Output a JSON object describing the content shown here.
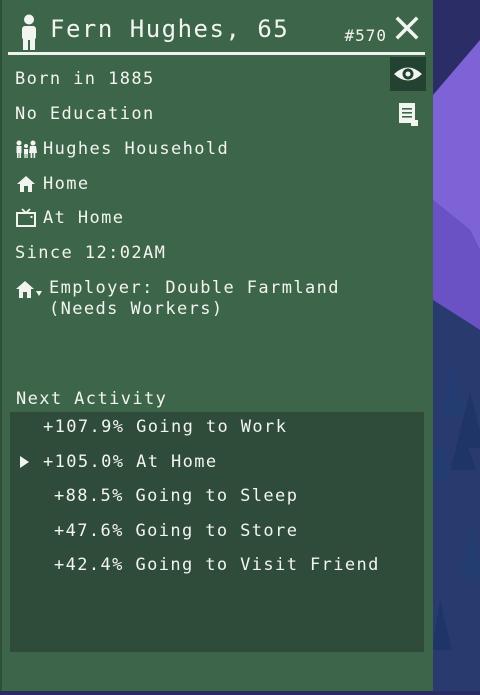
{
  "citizen": {
    "name": "Fern Hughes, 65",
    "id": "#570",
    "born": "Born in 1885",
    "education": "No Education",
    "household": "Hughes Household",
    "home": "Home",
    "status": "At Home",
    "since": "Since 12:02AM",
    "employer": "Employer: Double Farmland (Needs Workers)"
  },
  "next_activity": {
    "label": "Next Activity",
    "items": [
      {
        "text": "+107.9% Going to Work",
        "current": false
      },
      {
        "text": "+105.0% At Home",
        "current": true
      },
      {
        "text": "+88.5% Going to Sleep",
        "current": false
      },
      {
        "text": "+47.6% Going to Store",
        "current": false
      },
      {
        "text": "+42.4% Going to Visit Friend",
        "current": false
      }
    ]
  },
  "icons": {
    "person": "person-icon",
    "close": "close-icon",
    "eye": "eye-icon",
    "document": "document-icon",
    "household": "family-icon",
    "home": "house-icon",
    "status": "tv-icon",
    "employer": "workplace-icon",
    "current_marker": "triangle-right-icon"
  },
  "colors": {
    "panel": "#3d6549",
    "activity_box": "#2f4b3a",
    "text": "#f2f5ef",
    "background": "#2a2c63",
    "accent_purple": "#7e63d6"
  }
}
